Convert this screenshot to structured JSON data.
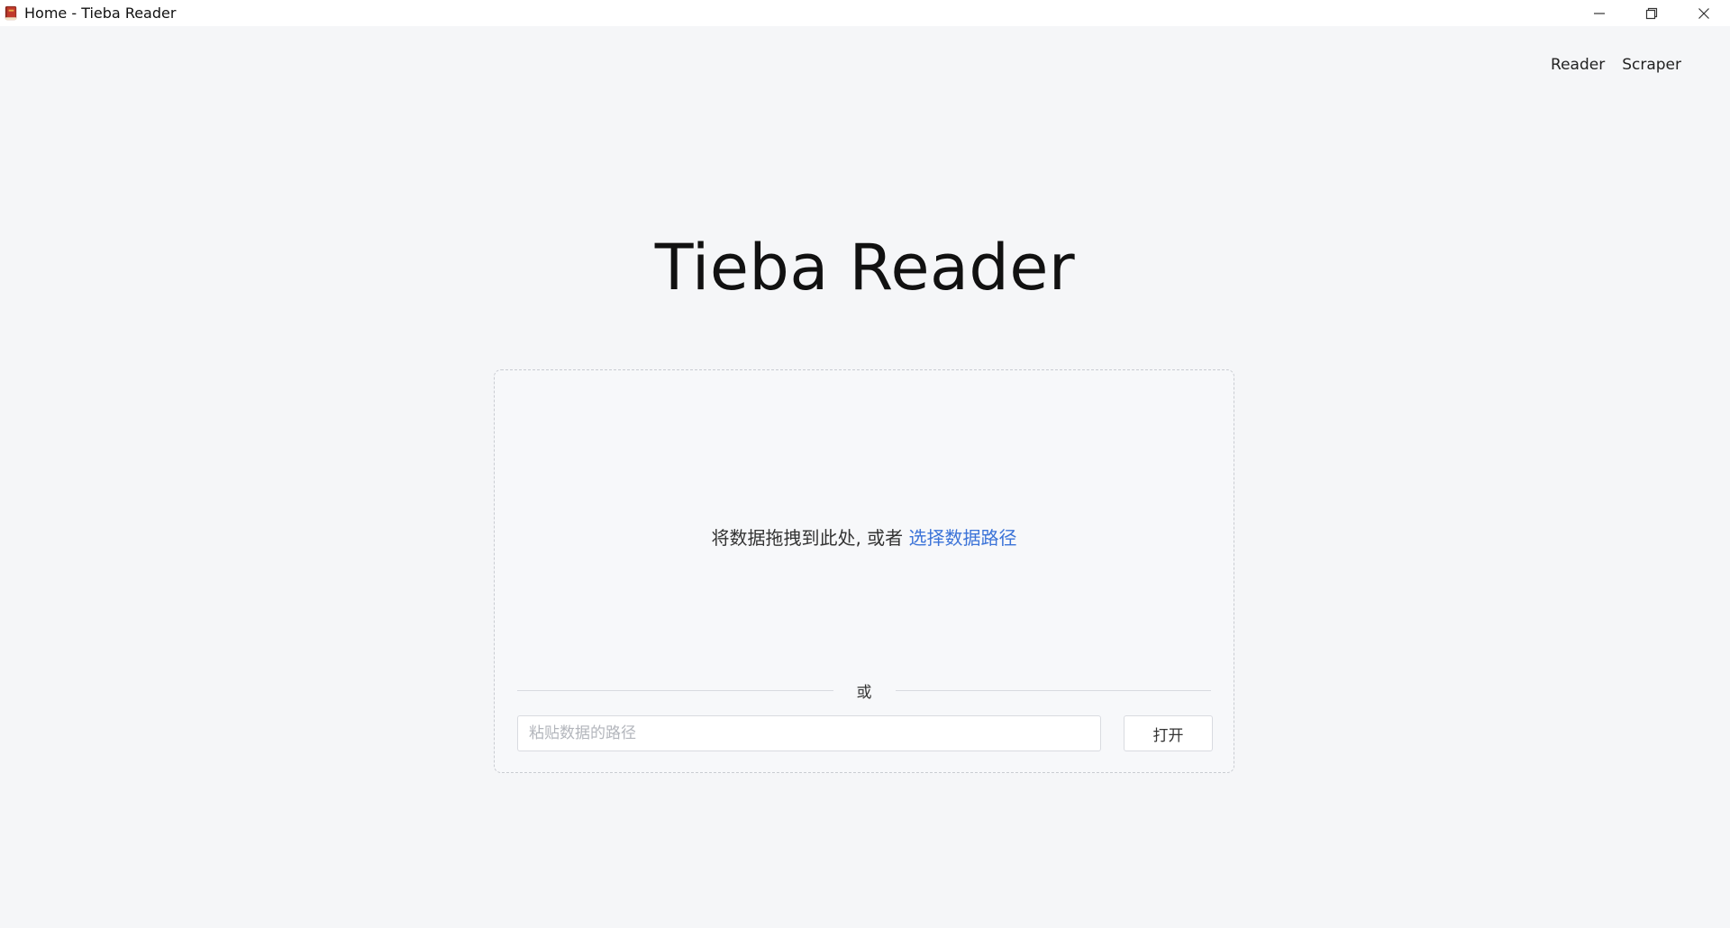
{
  "window": {
    "title": "Home - Tieba Reader",
    "icon": "book-icon",
    "controls": [
      "minimize-icon",
      "restore-icon",
      "close-icon"
    ]
  },
  "nav": {
    "items": [
      {
        "label": "Reader"
      },
      {
        "label": "Scraper"
      }
    ]
  },
  "hero": {
    "title": "Tieba Reader"
  },
  "drop": {
    "text": "将数据拖拽到此处, 或者 ",
    "link_text": "选择数据路径",
    "divider_text": "或",
    "input_placeholder": "粘贴数据的路径",
    "input_value": "",
    "open_label": "打开"
  },
  "colors": {
    "background": "#f5f6f8",
    "link": "#3b73d8",
    "panel_border": "#c9ccd2"
  }
}
